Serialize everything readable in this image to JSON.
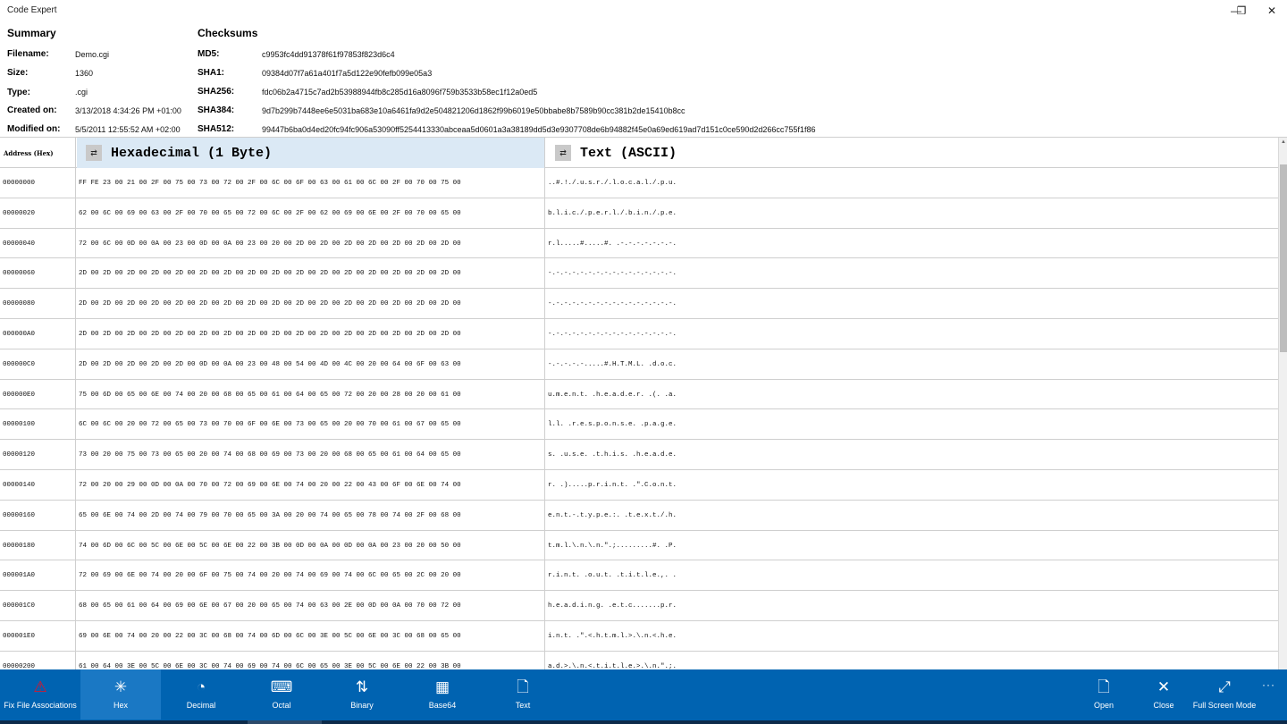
{
  "window": {
    "title": "Code Expert",
    "minimize_icon": "minimize-icon",
    "maximize_icon": "restore-icon",
    "close_icon": "close-icon"
  },
  "summary": {
    "heading": "Summary",
    "labels": {
      "filename": "Filename:",
      "size": "Size:",
      "type": "Type:",
      "created": "Created on:",
      "modified": "Modified on:"
    },
    "values": {
      "filename": "Demo.cgi",
      "size": "1360",
      "type": ".cgi",
      "created": "3/13/2018 4:34:26 PM +01:00",
      "modified": "5/5/2011 12:55:52 AM +02:00"
    }
  },
  "checksums": {
    "heading": "Checksums",
    "labels": {
      "md5": "MD5:",
      "sha1": "SHA1:",
      "sha256": "SHA256:",
      "sha384": "SHA384:",
      "sha512": "SHA512:"
    },
    "values": {
      "md5": "c9953fc4dd91378f61f97853f823d6c4",
      "sha1": "09384d07f7a61a401f7a5d122e90fefb099e05a3",
      "sha256": "fdc06b2a4715c7ad2b53988944fb8c285d16a8096f759b3533b58ec1f12a0ed5",
      "sha384": "9d7b299b7448ee6e5031ba683e10a6461fa9d2e504821206d1862f99b6019e50bbabe8b7589b90cc381b2de15410b8cc",
      "sha512": "99447b6ba0d4ed20fc94fc906a53090ff5254413330abceaa5d0601a3a38189dd5d3e9307708de6b94882f45e0a69ed619ad7d151c0ce590d2d266cc755f1f86"
    }
  },
  "grid": {
    "address_header": "Address (Hex)",
    "hex_header": "Hexadecimal (1 Byte)",
    "text_header": "Text (ASCII)",
    "rows": [
      {
        "addr": "00000000",
        "hex": "FF FE 23 00 21 00 2F 00 75 00 73 00 72 00 2F 00 6C 00 6F 00 63 00 61 00 6C 00 2F 00 70 00 75 00",
        "text": "..#.!./.u.s.r./.l.o.c.a.l./.p.u."
      },
      {
        "addr": "00000020",
        "hex": "62 00 6C 00 69 00 63 00 2F 00 70 00 65 00 72 00 6C 00 2F 00 62 00 69 00 6E 00 2F 00 70 00 65 00",
        "text": "b.l.i.c./.p.e.r.l./.b.i.n./.p.e."
      },
      {
        "addr": "00000040",
        "hex": "72 00 6C 00 0D 00 0A 00 23 00 0D 00 0A 00 23 00 20 00 2D 00 2D 00 2D 00 2D 00 2D 00 2D 00 2D 00",
        "text": "r.l.....#.....#. .-.-.-.-.-.-.-."
      },
      {
        "addr": "00000060",
        "hex": "2D 00 2D 00 2D 00 2D 00 2D 00 2D 00 2D 00 2D 00 2D 00 2D 00 2D 00 2D 00 2D 00 2D 00 2D 00 2D 00",
        "text": "-.-.-.-.-.-.-.-.-.-.-.-.-.-.-.-."
      },
      {
        "addr": "00000080",
        "hex": "2D 00 2D 00 2D 00 2D 00 2D 00 2D 00 2D 00 2D 00 2D 00 2D 00 2D 00 2D 00 2D 00 2D 00 2D 00 2D 00",
        "text": "-.-.-.-.-.-.-.-.-.-.-.-.-.-.-.-."
      },
      {
        "addr": "000000A0",
        "hex": "2D 00 2D 00 2D 00 2D 00 2D 00 2D 00 2D 00 2D 00 2D 00 2D 00 2D 00 2D 00 2D 00 2D 00 2D 00 2D 00",
        "text": "-.-.-.-.-.-.-.-.-.-.-.-.-.-.-.-."
      },
      {
        "addr": "000000C0",
        "hex": "2D 00 2D 00 2D 00 2D 00 2D 00 0D 00 0A 00 23 00 48 00 54 00 4D 00 4C 00 20 00 64 00 6F 00 63 00",
        "text": "-.-.-.-.-.....#.H.T.M.L. .d.o.c."
      },
      {
        "addr": "000000E0",
        "hex": "75 00 6D 00 65 00 6E 00 74 00 20 00 68 00 65 00 61 00 64 00 65 00 72 00 20 00 28 00 20 00 61 00",
        "text": "u.m.e.n.t. .h.e.a.d.e.r. .(. .a."
      },
      {
        "addr": "00000100",
        "hex": "6C 00 6C 00 20 00 72 00 65 00 73 00 70 00 6F 00 6E 00 73 00 65 00 20 00 70 00 61 00 67 00 65 00",
        "text": "l.l. .r.e.s.p.o.n.s.e. .p.a.g.e."
      },
      {
        "addr": "00000120",
        "hex": "73 00 20 00 75 00 73 00 65 00 20 00 74 00 68 00 69 00 73 00 20 00 68 00 65 00 61 00 64 00 65 00",
        "text": "s. .u.s.e. .t.h.i.s. .h.e.a.d.e."
      },
      {
        "addr": "00000140",
        "hex": "72 00 20 00 29 00 0D 00 0A 00 70 00 72 00 69 00 6E 00 74 00 20 00 22 00 43 00 6F 00 6E 00 74 00",
        "text": "r. .).....p.r.i.n.t. .\".C.o.n.t."
      },
      {
        "addr": "00000160",
        "hex": "65 00 6E 00 74 00 2D 00 74 00 79 00 70 00 65 00 3A 00 20 00 74 00 65 00 78 00 74 00 2F 00 68 00",
        "text": "e.n.t.-.t.y.p.e.:. .t.e.x.t./.h."
      },
      {
        "addr": "00000180",
        "hex": "74 00 6D 00 6C 00 5C 00 6E 00 5C 00 6E 00 22 00 3B 00 0D 00 0A 00 0D 00 0A 00 23 00 20 00 50 00",
        "text": "t.m.l.\\.n.\\.n.\".;.........#. .P."
      },
      {
        "addr": "000001A0",
        "hex": "72 00 69 00 6E 00 74 00 20 00 6F 00 75 00 74 00 20 00 74 00 69 00 74 00 6C 00 65 00 2C 00 20 00",
        "text": "r.i.n.t. .o.u.t. .t.i.t.l.e.,. ."
      },
      {
        "addr": "000001C0",
        "hex": "68 00 65 00 61 00 64 00 69 00 6E 00 67 00 20 00 65 00 74 00 63 00 2E 00 0D 00 0A 00 70 00 72 00",
        "text": "h.e.a.d.i.n.g. .e.t.c.......p.r."
      },
      {
        "addr": "000001E0",
        "hex": "69 00 6E 00 74 00 20 00 22 00 3C 00 68 00 74 00 6D 00 6C 00 3E 00 5C 00 6E 00 3C 00 68 00 65 00",
        "text": "i.n.t. .\".<.h.t.m.l.>.\\.n.<.h.e."
      },
      {
        "addr": "00000200",
        "hex": "61 00 64 00 3E 00 5C 00 6E 00 3C 00 74 00 69 00 74 00 6C 00 65 00 3E 00 5C 00 6E 00 22 00 3B 00",
        "text": "a.d.>.\\.n.<.t.i.t.l.e.>.\\.n.\".;."
      }
    ]
  },
  "appbar": {
    "buttons": [
      {
        "id": "fix-file-associations",
        "label": "Fix File Associations",
        "icon": "warning-icon",
        "glyph": "⚠",
        "color": "#e81123"
      },
      {
        "id": "hex",
        "label": "Hex",
        "icon": "asterisk-icon",
        "glyph": "✳",
        "active": true
      },
      {
        "id": "decimal",
        "label": "Decimal",
        "icon": "pie-chart-icon",
        "glyph": "◔"
      },
      {
        "id": "octal",
        "label": "Octal",
        "icon": "keyboard-icon",
        "glyph": "⌨"
      },
      {
        "id": "binary",
        "label": "Binary",
        "icon": "sort-arrows-icon",
        "glyph": "⇅"
      },
      {
        "id": "base64",
        "label": "Base64",
        "icon": "grid-icon",
        "glyph": "▦"
      },
      {
        "id": "text",
        "label": "Text",
        "icon": "document-icon",
        "glyph": "🗋"
      },
      {
        "id": "open",
        "label": "Open",
        "icon": "open-file-icon",
        "glyph": "🗋"
      },
      {
        "id": "close",
        "label": "Close",
        "icon": "close-icon",
        "glyph": "✕"
      },
      {
        "id": "full-screen-mode",
        "label": "Full Screen Mode",
        "icon": "full-screen-icon",
        "glyph": "⤢"
      }
    ],
    "more_label": "···"
  },
  "colors": {
    "accent": "#0063b1",
    "active_button": "#1a78c4",
    "header_highlight": "#dbe9f5",
    "warning": "#e81123"
  }
}
